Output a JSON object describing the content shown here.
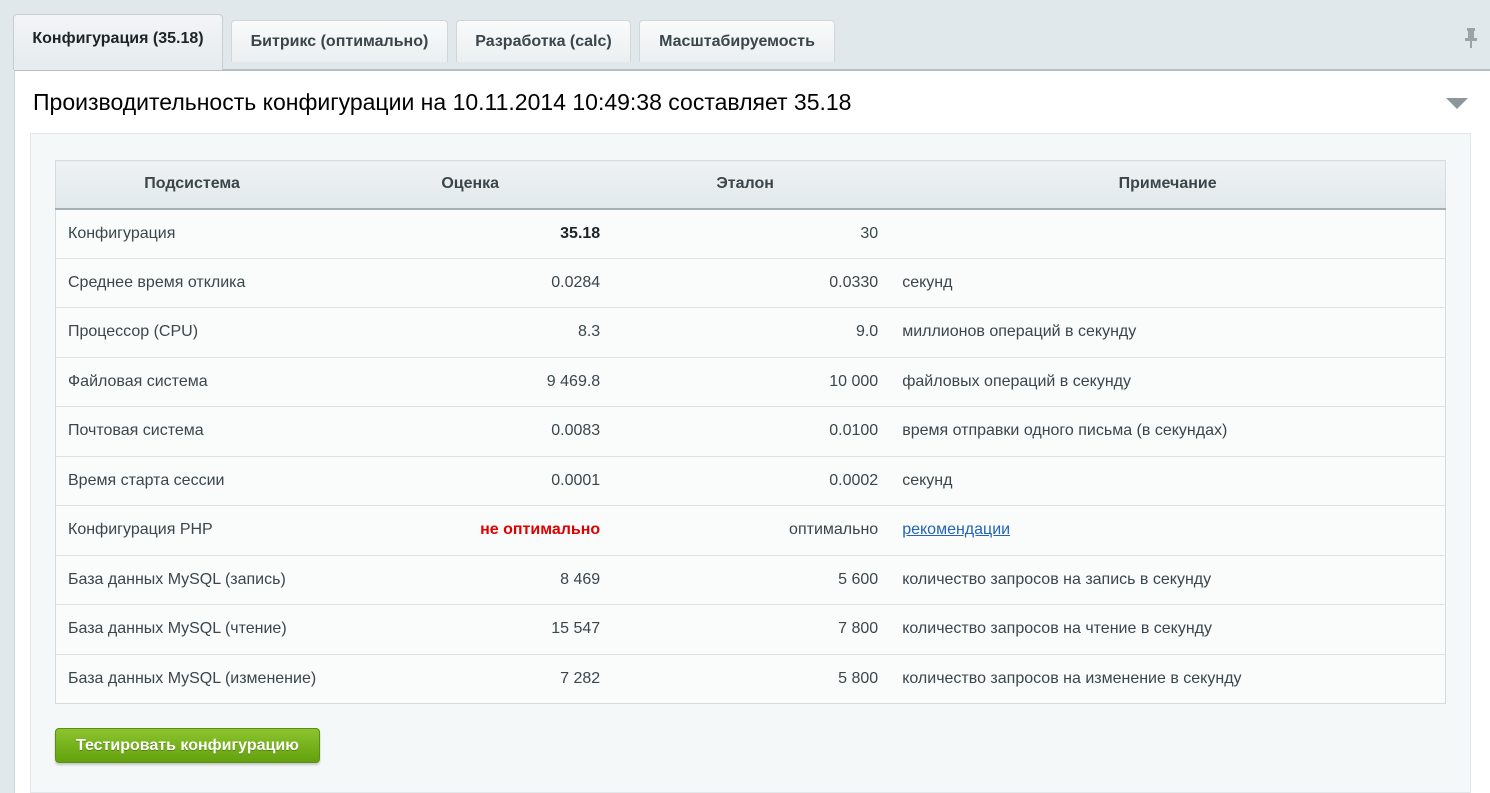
{
  "tabs": [
    {
      "label": "Конфигурация (35.18)"
    },
    {
      "label": "Битрикс (оптимально)"
    },
    {
      "label": "Разработка (calc)"
    },
    {
      "label": "Масштабируемость"
    }
  ],
  "title": "Производительность конфигурации на 10.11.2014 10:49:38 составляет 35.18",
  "table": {
    "headers": [
      "Подсистема",
      "Оценка",
      "Эталон",
      "Примечание"
    ],
    "rows": [
      {
        "name": "Конфигурация",
        "score": "35.18",
        "ref": "30",
        "note": ""
      },
      {
        "name": "Среднее время отклика",
        "score": "0.0284",
        "ref": "0.0330",
        "note": "секунд"
      },
      {
        "name": "Процессор (CPU)",
        "score": "8.3",
        "ref": "9.0",
        "note": "миллионов операций в секунду"
      },
      {
        "name": "Файловая система",
        "score": "9 469.8",
        "ref": "10 000",
        "note": "файловых операций в секунду"
      },
      {
        "name": "Почтовая система",
        "score": "0.0083",
        "ref": "0.0100",
        "note": "время отправки одного письма (в секундах)"
      },
      {
        "name": "Время старта сессии",
        "score": "0.0001",
        "ref": "0.0002",
        "note": "секунд"
      },
      {
        "name": "Конфигурация PHP",
        "score": "не оптимально",
        "ref": "оптимально",
        "note": "рекомендации"
      },
      {
        "name": "База данных MySQL (запись)",
        "score": "8 469",
        "ref": "5 600",
        "note": "количество запросов на запись в секунду"
      },
      {
        "name": "База данных MySQL (чтение)",
        "score": "15 547",
        "ref": "7 800",
        "note": "количество запросов на чтение в секунду"
      },
      {
        "name": "База данных MySQL (изменение)",
        "score": "7 282",
        "ref": "5 800",
        "note": "количество запросов на изменение в секунду"
      }
    ]
  },
  "button": {
    "label": "Тестировать конфигурацию"
  },
  "colors": {
    "accent_green": "#6aaa14",
    "warning_red": "#e00000",
    "link_blue": "#2164b8"
  },
  "icons": {
    "pin": "pin-icon",
    "collapse": "collapse-arrow-icon"
  }
}
